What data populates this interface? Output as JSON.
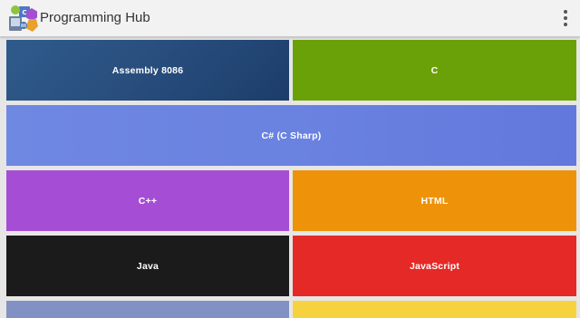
{
  "app": {
    "title": "Programming Hub"
  },
  "icons": {
    "logo": "programming-hub-logo-icon",
    "menu": "overflow-menu-icon"
  },
  "tiles": [
    {
      "label": "Assembly 8086",
      "color": "#294f7e"
    },
    {
      "label": "C",
      "color": "#6ba108"
    },
    {
      "label": "C# (C Sharp)",
      "color": "#6a82e0"
    },
    {
      "label": "C++",
      "color": "#a54ed5"
    },
    {
      "label": "HTML",
      "color": "#ee9209"
    },
    {
      "label": "Java",
      "color": "#1b1b1b"
    },
    {
      "label": "JavaScript",
      "color": "#e52927"
    },
    {
      "label": "",
      "color": "#8191c4"
    },
    {
      "label": "",
      "color": "#f7d23f"
    }
  ]
}
